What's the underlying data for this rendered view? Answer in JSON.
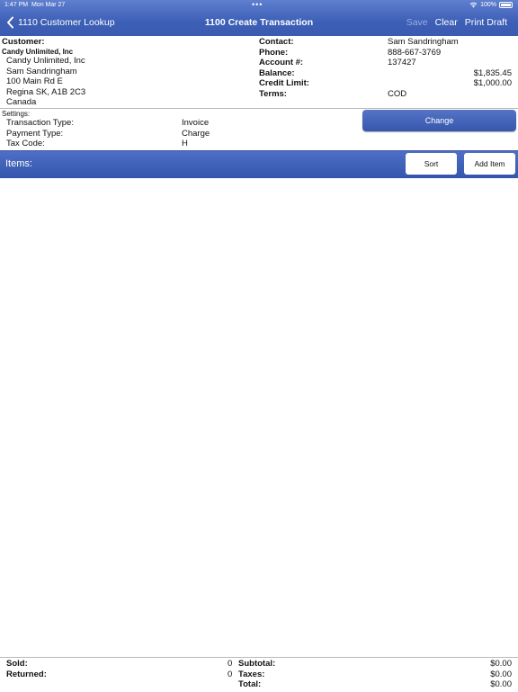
{
  "status_bar": {
    "time": "1:47 PM",
    "date": "Mon Mar 27",
    "dots": "•••",
    "battery": "100%"
  },
  "nav": {
    "back_label": "1110 Customer Lookup",
    "title": "1100 Create Transaction",
    "save": "Save",
    "clear": "Clear",
    "print_draft": "Print Draft"
  },
  "customer": {
    "heading": "Customer:",
    "company_bold": "Candy Unlimited, Inc",
    "address": [
      "Candy Unlimited, Inc",
      "Sam Sandringham",
      "100 Main Rd E",
      "Regina SK, A1B 2C3",
      "Canada"
    ],
    "contact_label": "Contact:",
    "contact": "Sam Sandringham",
    "phone_label": "Phone:",
    "phone": "888-667-3769",
    "account_label": "Account #:",
    "account": "137427",
    "balance_label": "Balance:",
    "balance": "$1,835.45",
    "credit_label": "Credit Limit:",
    "credit": "$1,000.00",
    "terms_label": "Terms:",
    "terms": "COD"
  },
  "settings": {
    "heading": "Settings:",
    "transaction_type_label": "Transaction Type:",
    "transaction_type": "Invoice",
    "payment_type_label": "Payment Type:",
    "payment_type": "Charge",
    "tax_code_label": "Tax Code:",
    "tax_code": "H",
    "change_button": "Change"
  },
  "items": {
    "title": "Items:",
    "sort_button": "Sort",
    "add_item_button": "Add Item"
  },
  "footer": {
    "sold_label": "Sold:",
    "sold": "0",
    "returned_label": "Returned:",
    "returned": "0",
    "subtotal_label": "Subtotal:",
    "subtotal": "$0.00",
    "taxes_label": "Taxes:",
    "taxes": "$0.00",
    "total_label": "Total:",
    "total": "$0.00"
  }
}
